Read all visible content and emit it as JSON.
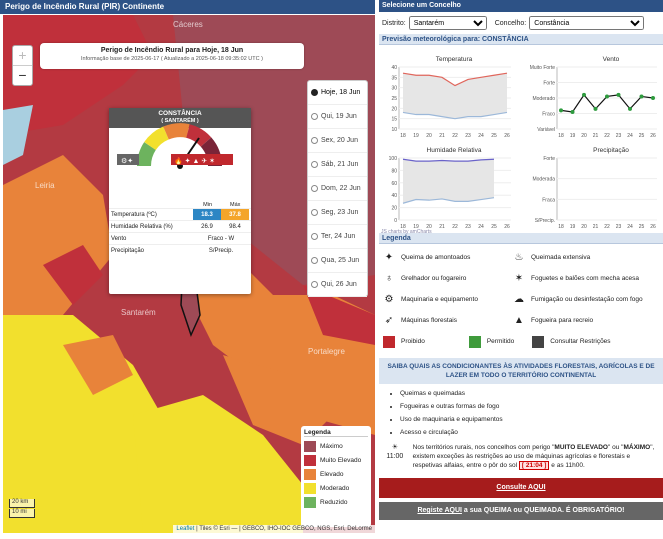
{
  "map": {
    "header": "Perigo de Incêndio Rural (PIR) Continente",
    "title": "Perigo de Incêndio Rural para Hoje, 18 Jun",
    "info": "Informação base de 2025-06-17 ( Atualizado a 2025-06-18 09:35:02 UTC )",
    "zoom_in": "+",
    "zoom_out": "−",
    "place_labels": [
      "Leiria",
      "Santarém",
      "Portalegre",
      "Cáceres"
    ],
    "days": [
      "Hoje, 18 Jun",
      "Qui, 19 Jun",
      "Sex, 20 Jun",
      "Sáb, 21 Jun",
      "Dom, 22 Jun",
      "Seg, 23 Jun",
      "Ter, 24 Jun",
      "Qua, 25 Jun",
      "Qui, 26 Jun"
    ],
    "selected_day": 0,
    "popup": {
      "name": "CONSTÂNCIA",
      "district": "( SANTARÉM )",
      "min_label": "Min",
      "max_label": "Máx",
      "rows": [
        {
          "label": "Temperatura (ºC)",
          "min": "18.3",
          "max": "37.8"
        },
        {
          "label": "Humidade Relativa (%)",
          "min": "26.9",
          "max": "98.4"
        },
        {
          "label": "Vento",
          "value": "Fraco - W"
        },
        {
          "label": "Precipitação",
          "value": "S/Precip."
        }
      ]
    },
    "legend": {
      "title": "Legenda",
      "items": [
        {
          "label": "Máximo",
          "color": "#9e4a56"
        },
        {
          "label": "Muito Elevado",
          "color": "#c0303b"
        },
        {
          "label": "Elevado",
          "color": "#e8833a"
        },
        {
          "label": "Moderado",
          "color": "#f2e02d"
        },
        {
          "label": "Reduzido",
          "color": "#6db35e"
        }
      ]
    },
    "scale_km": "20 km",
    "scale_mi": "10 mi",
    "attribution_leaflet": "Leaflet",
    "attribution_rest": " | Tiles © Esri — | GEBCO, IHO-IOC GEBCO, NGS, Esri, DeLorme"
  },
  "side": {
    "header": "Selecione um Concelho",
    "district_label": "Distrito:",
    "district_value": "Santarém",
    "county_label": "Concelho:",
    "county_value": "Constância",
    "forecast_label": "Previsão meteorológica para: CONSTÂNCIA",
    "credit": "JS charts by amCharts",
    "legend_title": "Legenda",
    "legend_items": [
      [
        "Queima de amontoados",
        "Queimada extensiva"
      ],
      [
        "Grelhador ou fogareiro",
        "Foguetes e balões com mecha acesa"
      ],
      [
        "Maquinaria e equipamento",
        "Fumigação ou desinfestação com fogo"
      ],
      [
        "Máquinas florestais",
        "Fogueira para recreio"
      ]
    ],
    "status": [
      {
        "label": "Proibido",
        "color": "#c0282d"
      },
      {
        "label": "Permitido",
        "color": "#3f9b3c"
      },
      {
        "label": "Consultar Restrições",
        "color": "#444444"
      }
    ],
    "info_title": "SAIBA QUAIS AS CONDICIONANTES ÀS ATIVIDADES FLORESTAIS, AGRÍCOLAS E DE LAZER EM TODO O TERRITÓRIO CONTINENTAL",
    "info_items": [
      "Queimas e queimadas",
      "Fogueiras e outras formas de fogo",
      "Uso de maquinaria e equipamentos",
      "Acesso e circulação"
    ],
    "rule_pre": "Nos territórios rurais, nos concelhos com perigo \"",
    "rule_a": "MUITO ELEVADO",
    "rule_mid": "\" ou \"",
    "rule_b": "MÁXIMO",
    "rule_text": "\", existem exceções às restrições ao uso de máquinas agrícolas e florestais e respetivas alfaias, entre o pôr do sol",
    "rule_time": "[ 21:04 ]",
    "rule_end": "e as 11h00.",
    "clock": "11:00",
    "btn1": "Consulte AQUI",
    "btn2_link": "Registe AQUI",
    "btn2_text": " a sua QUEIMA ou QUEIMADA. É OBRIGATÓRIO!"
  },
  "chart_data": [
    {
      "type": "line",
      "title": "Temperatura",
      "x": [
        "18",
        "19",
        "20",
        "21",
        "22",
        "23",
        "24",
        "25",
        "26"
      ],
      "series": [
        {
          "values": [
            37,
            36,
            36,
            35,
            31,
            34,
            35,
            36,
            37
          ],
          "color": "#e0665c"
        },
        {
          "values": [
            18,
            17,
            17,
            16,
            15,
            16,
            16,
            17,
            18
          ],
          "color": "#9cb8d9"
        }
      ],
      "ylim": [
        10,
        40
      ],
      "yticks": [
        "40",
        "35",
        "30",
        "25",
        "20",
        "15",
        "10"
      ]
    },
    {
      "type": "line",
      "title": "Vento",
      "x": [
        "18",
        "19",
        "20",
        "21",
        "22",
        "23",
        "24",
        "25",
        "26"
      ],
      "yticks": [
        "Muito Forte",
        "Forte",
        "Moderado",
        "Fraco",
        "Variável"
      ],
      "series": [
        {
          "values": [
            1.2,
            1.1,
            2.2,
            1.3,
            2.1,
            2.2,
            1.3,
            2.1,
            2.0
          ],
          "color": "#111111"
        }
      ]
    },
    {
      "type": "line",
      "title": "Humidade Relativa",
      "x": [
        "18",
        "19",
        "20",
        "21",
        "22",
        "23",
        "24",
        "25",
        "26"
      ],
      "series": [
        {
          "values": [
            98,
            95,
            95,
            96,
            95,
            95,
            97,
            98
          ],
          "color": "#6a63c9"
        },
        {
          "values": [
            27,
            33,
            32,
            34,
            30,
            30,
            33,
            36
          ],
          "color": "#9cb8d9"
        }
      ],
      "ylim": [
        0,
        100
      ],
      "yticks": [
        "100",
        "80",
        "60",
        "40",
        "20",
        "0"
      ]
    },
    {
      "type": "line",
      "title": "Precipitação",
      "x": [
        "18",
        "19",
        "20",
        "21",
        "22",
        "23",
        "24",
        "25",
        "26"
      ],
      "yticks": [
        "Forte",
        "Moderada",
        "Fraca",
        "S/Precip."
      ],
      "series": []
    }
  ]
}
